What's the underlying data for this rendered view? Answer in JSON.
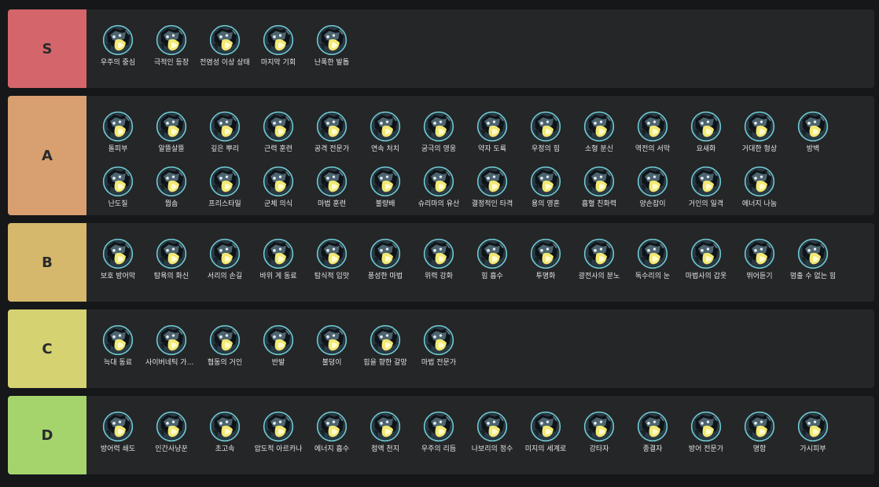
{
  "tiers": [
    {
      "name": "S",
      "color": "#d4666b",
      "items": [
        "우주의 중심",
        "극적인 등장",
        "전염성 이상 상태",
        "마지막 기회",
        "난폭한 발톱"
      ]
    },
    {
      "name": "A",
      "color": "#d8a070",
      "items": [
        "돌피부",
        "알뜰살뜰",
        "깊은 뿌리",
        "근력 훈련",
        "공격 전문가",
        "연속 처치",
        "궁극의 영웅",
        "약자 도륙",
        "우정의 힘",
        "소형 분신",
        "역전의 서막",
        "요새화",
        "거대한 형상",
        "방벽",
        "난도질",
        "뭡솜",
        "프리스타일",
        "군체 의식",
        "마법 훈련",
        "불량배",
        "슈리마의 유산",
        "결정적인 타격",
        "용의 영혼",
        "흡혈 친화력",
        "양손잡이",
        "거인의 일격",
        "에너지 나눔"
      ]
    },
    {
      "name": "B",
      "color": "#d6b86c",
      "items": [
        "보호 방어막",
        "탐욕의 화신",
        "서리의 손길",
        "바위 게 동료",
        "탐식적 입맛",
        "풍성한 마법",
        "위력 강화",
        "힘 흡수",
        "투명화",
        "광전사의 분노",
        "독수리의 눈",
        "마법사의 갑옷",
        "뛰어듣기",
        "멈출 수 없는 힘"
      ]
    },
    {
      "name": "C",
      "color": "#d5d272",
      "items": [
        "늑대 동료",
        "사이버네틱 가속기",
        "협동의 거인",
        "반발",
        "불덩이",
        "힘을 향한 갈망",
        "마법 전문가"
      ]
    },
    {
      "name": "D",
      "color": "#a5d46c",
      "items": [
        "방어력 쇄도",
        "인간사냥꾼",
        "초고속",
        "압도적 아르카나",
        "에너지 흡수",
        "점액 천지",
        "우주의 리듬",
        "나보리의 정수",
        "미지의 세계로",
        "강타자",
        "종결자",
        "방어 전문가",
        "명함",
        "가시피부"
      ]
    }
  ],
  "icon": "augment-portrait-icon"
}
